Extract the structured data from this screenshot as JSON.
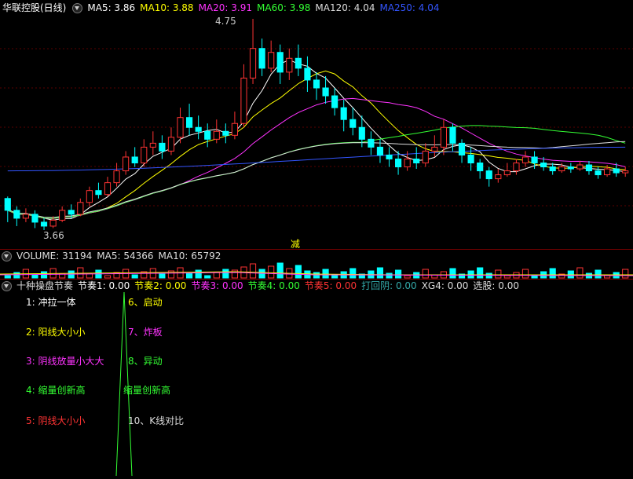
{
  "main": {
    "title": "华联控股(日线)",
    "ma": [
      {
        "label": "MA5: 3.86",
        "color": "#ffffff"
      },
      {
        "label": "MA10: 3.88",
        "color": "#ffff00"
      },
      {
        "label": "MA20: 3.91",
        "color": "#ff33ff"
      },
      {
        "label": "MA60: 3.98",
        "color": "#33ff33"
      },
      {
        "label": "MA120: 4.04",
        "color": "#dddddd"
      },
      {
        "label": "MA250: 4.04",
        "color": "#3355ff"
      }
    ],
    "high_label": "4.75",
    "low_label": "3.66",
    "marker": "减"
  },
  "volume": {
    "items": [
      {
        "label": "VOLUME: 31194",
        "color": "#dddddd"
      },
      {
        "label": "MA5: 54366",
        "color": "#dddddd"
      },
      {
        "label": "MA10: 65792",
        "color": "#dddddd"
      }
    ]
  },
  "indicator": {
    "title": "十种操盘节奏",
    "items": [
      {
        "label": "节奏1: 0.00",
        "color": "#ffffff"
      },
      {
        "label": "节奏2: 0.00",
        "color": "#ffff00"
      },
      {
        "label": "节奏3: 0.00",
        "color": "#ff33ff"
      },
      {
        "label": "节奏4: 0.00",
        "color": "#33ff33"
      },
      {
        "label": "节奏5: 0.00",
        "color": "#ff3333"
      },
      {
        "label": "打回阴: 0.00",
        "color": "#33aaaa"
      },
      {
        "label": "XG4: 0.00",
        "color": "#dddddd"
      },
      {
        "label": "选股: 0.00",
        "color": "#dddddd"
      }
    ],
    "legend_left": [
      {
        "text": "1: 冲拉一体",
        "color": "#ffffff"
      },
      {
        "text": "2: 阳线大小小",
        "color": "#ffff00"
      },
      {
        "text": "3: 阴线放量小大大",
        "color": "#ff33ff"
      },
      {
        "text": "4: 缩量创新高",
        "color": "#33ff33"
      },
      {
        "text": "5: 阴线大小小",
        "color": "#ff3333"
      }
    ],
    "legend_right": [
      {
        "text": "6、启动",
        "color": "#ffff00"
      },
      {
        "text": "7、炸板",
        "color": "#ff33ff"
      },
      {
        "text": "8、异动",
        "color": "#33ff33"
      },
      {
        "text": "缩量创新高",
        "color": "#33ff33"
      },
      {
        "text": "10、K线对比",
        "color": "#dddddd"
      }
    ]
  },
  "colors": {
    "up": "#ff3333",
    "down": "#00ffff",
    "ma5": "#ffffff",
    "ma10": "#ffff00",
    "ma20": "#ff33ff",
    "ma60": "#33ff33",
    "ma120": "#dddddd",
    "ma250": "#3355ff",
    "divider": "#7a0000"
  },
  "chart_data": {
    "type": "candlestick",
    "y_range": [
      3.66,
      4.75
    ],
    "candles": [
      [
        3.84,
        3.78,
        3.85,
        3.72
      ],
      [
        3.78,
        3.74,
        3.8,
        3.7
      ],
      [
        3.74,
        3.76,
        3.79,
        3.72
      ],
      [
        3.76,
        3.72,
        3.78,
        3.69
      ],
      [
        3.72,
        3.7,
        3.74,
        3.68
      ],
      [
        3.7,
        3.73,
        3.75,
        3.69
      ],
      [
        3.73,
        3.78,
        3.8,
        3.72
      ],
      [
        3.78,
        3.76,
        3.81,
        3.74
      ],
      [
        3.76,
        3.82,
        3.84,
        3.75
      ],
      [
        3.82,
        3.88,
        3.9,
        3.8
      ],
      [
        3.88,
        3.86,
        3.92,
        3.84
      ],
      [
        3.86,
        3.92,
        3.95,
        3.85
      ],
      [
        3.92,
        3.98,
        4.02,
        3.9
      ],
      [
        3.98,
        4.05,
        4.08,
        3.96
      ],
      [
        4.05,
        4.02,
        4.1,
        4.0
      ],
      [
        4.02,
        4.1,
        4.14,
        4.0
      ],
      [
        4.1,
        4.12,
        4.18,
        4.06
      ],
      [
        4.12,
        4.08,
        4.16,
        4.04
      ],
      [
        4.08,
        4.15,
        4.2,
        4.06
      ],
      [
        4.15,
        4.25,
        4.3,
        4.12
      ],
      [
        4.25,
        4.2,
        4.32,
        4.16
      ],
      [
        4.2,
        4.18,
        4.26,
        4.14
      ],
      [
        4.18,
        4.14,
        4.22,
        4.1
      ],
      [
        4.14,
        4.18,
        4.24,
        4.12
      ],
      [
        4.18,
        4.16,
        4.22,
        4.12
      ],
      [
        4.16,
        4.22,
        4.28,
        4.14
      ],
      [
        4.22,
        4.45,
        4.52,
        4.2
      ],
      [
        4.45,
        4.6,
        4.75,
        4.42
      ],
      [
        4.6,
        4.5,
        4.65,
        4.46
      ],
      [
        4.5,
        4.58,
        4.64,
        4.48
      ],
      [
        4.58,
        4.48,
        4.62,
        4.42
      ],
      [
        4.48,
        4.55,
        4.6,
        4.44
      ],
      [
        4.55,
        4.5,
        4.62,
        4.46
      ],
      [
        4.5,
        4.44,
        4.56,
        4.38
      ],
      [
        4.44,
        4.4,
        4.48,
        4.34
      ],
      [
        4.4,
        4.36,
        4.46,
        4.32
      ],
      [
        4.36,
        4.3,
        4.4,
        4.26
      ],
      [
        4.3,
        4.24,
        4.34,
        4.18
      ],
      [
        4.24,
        4.2,
        4.3,
        4.16
      ],
      [
        4.2,
        4.14,
        4.26,
        4.1
      ],
      [
        4.14,
        4.1,
        4.18,
        4.06
      ],
      [
        4.1,
        4.06,
        4.14,
        4.02
      ],
      [
        4.06,
        4.04,
        4.1,
        4.0
      ],
      [
        4.04,
        4.0,
        4.08,
        3.96
      ],
      [
        4.0,
        4.04,
        4.08,
        3.98
      ],
      [
        4.04,
        4.02,
        4.1,
        3.99
      ],
      [
        4.02,
        4.08,
        4.12,
        4.0
      ],
      [
        4.08,
        4.1,
        4.16,
        4.05
      ],
      [
        4.1,
        4.2,
        4.24,
        4.06
      ],
      [
        4.2,
        4.12,
        4.22,
        4.08
      ],
      [
        4.12,
        4.06,
        4.14,
        4.02
      ],
      [
        4.06,
        4.02,
        4.1,
        3.98
      ],
      [
        4.02,
        3.98,
        4.04,
        3.94
      ],
      [
        3.98,
        3.94,
        4.0,
        3.9
      ],
      [
        3.94,
        3.96,
        3.99,
        3.92
      ],
      [
        3.96,
        3.98,
        4.02,
        3.95
      ],
      [
        3.98,
        4.02,
        4.04,
        3.96
      ],
      [
        4.02,
        4.05,
        4.08,
        4.0
      ],
      [
        4.05,
        4.02,
        4.08,
        3.99
      ],
      [
        4.02,
        4.0,
        4.05,
        3.98
      ],
      [
        4.0,
        3.98,
        4.02,
        3.96
      ],
      [
        3.98,
        4.0,
        4.02,
        3.97
      ],
      [
        4.0,
        3.99,
        4.02,
        3.97
      ],
      [
        3.99,
        4.01,
        4.03,
        3.98
      ],
      [
        4.01,
        3.98,
        4.03,
        3.96
      ],
      [
        3.98,
        3.96,
        4.0,
        3.94
      ],
      [
        3.96,
        3.99,
        4.01,
        3.95
      ],
      [
        3.99,
        3.97,
        4.02,
        3.95
      ],
      [
        3.97,
        3.98,
        4.0,
        3.95
      ]
    ]
  }
}
